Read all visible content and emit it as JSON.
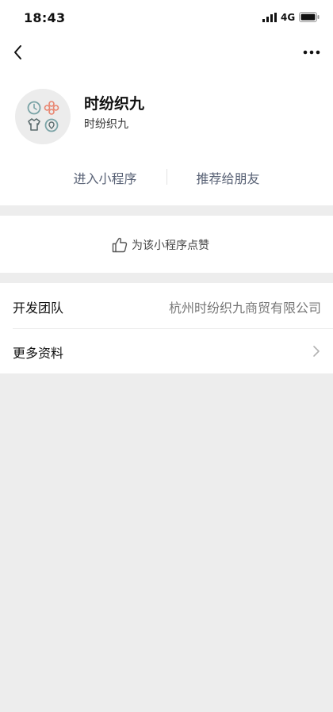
{
  "status_bar": {
    "time": "18:43",
    "network": "4G",
    "icons": [
      "signal-icon",
      "battery-icon"
    ]
  },
  "nav": {
    "icons": [
      "back-icon",
      "more-icon"
    ]
  },
  "profile": {
    "title": "时纷织九",
    "subtitle": "时纷织九",
    "avatar_icons": [
      "clock-icon",
      "flower-icon",
      "shirt-icon",
      "location-icon"
    ]
  },
  "actions": {
    "enter_label": "进入小程序",
    "share_label": "推荐给朋友"
  },
  "like": {
    "label": "为该小程序点赞",
    "icon": "thumbs-up-icon"
  },
  "info": {
    "rows": [
      {
        "label": "开发团队",
        "value": "杭州时纷织九商贸有限公司"
      },
      {
        "label": "更多资料",
        "icon": "chevron-right-icon"
      }
    ]
  },
  "colors": {
    "background": "#ededed",
    "card": "#ffffff",
    "link_text": "#576074",
    "secondary_text": "#777777",
    "avatar_teal": "#7aa3a6",
    "avatar_coral": "#e9846f"
  }
}
